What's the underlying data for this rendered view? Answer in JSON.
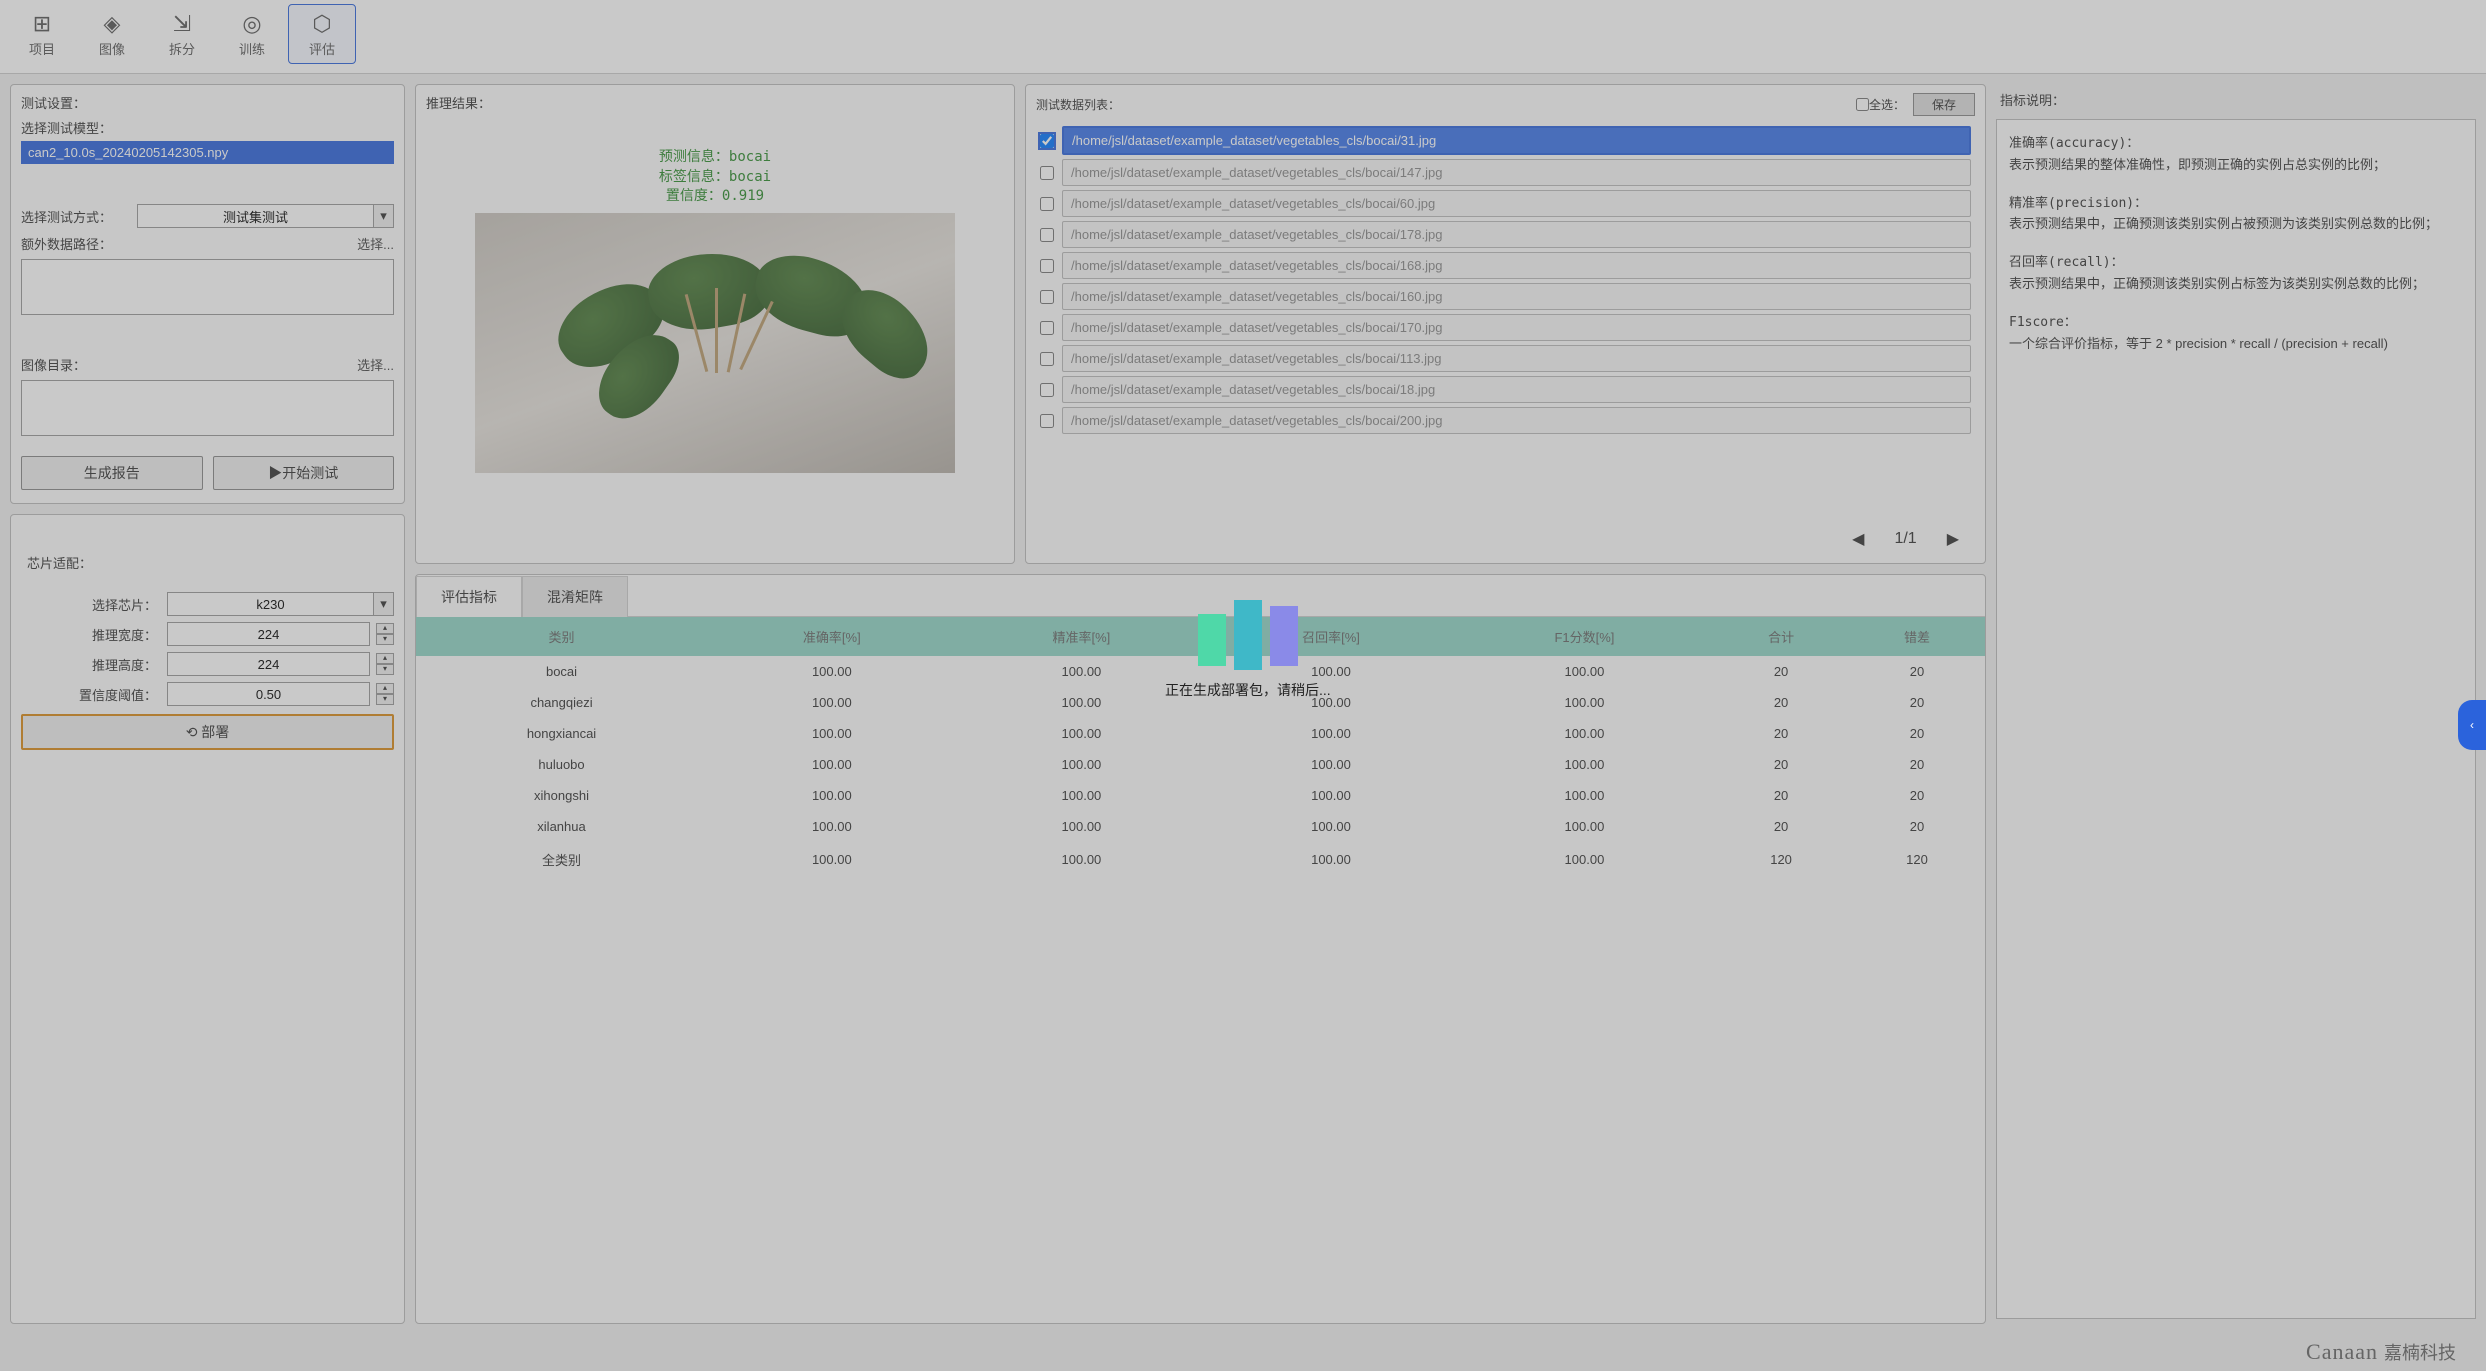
{
  "toolbar": {
    "items": [
      {
        "icon": "⊞",
        "label": "项目"
      },
      {
        "icon": "◈",
        "label": "图像"
      },
      {
        "icon": "⇲",
        "label": "拆分"
      },
      {
        "icon": "◎",
        "label": "训练"
      },
      {
        "icon": "⬡",
        "label": "评估"
      }
    ],
    "active_index": 4
  },
  "test_settings": {
    "title": "测试设置：",
    "model_label": "选择测试模型：",
    "model_value": "can2_10.0s_20240205142305.npy",
    "method_label": "选择测试方式：",
    "method_value": "测试集测试",
    "extra_path_label": "额外数据路径：",
    "extra_choose": "选择...",
    "image_dir_label": "图像目录：",
    "image_choose": "选择...",
    "gen_report": "生成报告",
    "start_test": "▶开始测试"
  },
  "chip": {
    "title": "芯片适配：",
    "chip_label": "选择芯片：",
    "chip_value": "k230",
    "width_label": "推理宽度：",
    "width_value": "224",
    "height_label": "推理高度：",
    "height_value": "224",
    "conf_label": "置信度阈值：",
    "conf_value": "0.50",
    "deploy": "⟲ 部署"
  },
  "inference": {
    "title": "推理结果：",
    "pred_line": "预测信息：bocai",
    "label_line": "标签信息：bocai",
    "conf_line": "置信度：0.919"
  },
  "datalist": {
    "title": "测试数据列表：",
    "select_all": "全选：",
    "save": "保存",
    "rows": [
      "/home/jsl/dataset/example_dataset/vegetables_cls/bocai/31.jpg",
      "/home/jsl/dataset/example_dataset/vegetables_cls/bocai/147.jpg",
      "/home/jsl/dataset/example_dataset/vegetables_cls/bocai/60.jpg",
      "/home/jsl/dataset/example_dataset/vegetables_cls/bocai/178.jpg",
      "/home/jsl/dataset/example_dataset/vegetables_cls/bocai/168.jpg",
      "/home/jsl/dataset/example_dataset/vegetables_cls/bocai/160.jpg",
      "/home/jsl/dataset/example_dataset/vegetables_cls/bocai/170.jpg",
      "/home/jsl/dataset/example_dataset/vegetables_cls/bocai/113.jpg",
      "/home/jsl/dataset/example_dataset/vegetables_cls/bocai/18.jpg",
      "/home/jsl/dataset/example_dataset/vegetables_cls/bocai/200.jpg"
    ],
    "selected_index": 0,
    "page": "1/1"
  },
  "tabs": {
    "metrics": "评估指标",
    "confusion": "混淆矩阵"
  },
  "metrics_table": {
    "headers": [
      "类别",
      "准确率[%]",
      "精准率[%]",
      "召回率[%]",
      "F1分数[%]",
      "合计",
      "错差"
    ],
    "rows": [
      [
        "bocai",
        "100.00",
        "100.00",
        "100.00",
        "100.00",
        "20",
        "20"
      ],
      [
        "changqiezi",
        "100.00",
        "100.00",
        "100.00",
        "100.00",
        "20",
        "20"
      ],
      [
        "hongxiancai",
        "100.00",
        "100.00",
        "100.00",
        "100.00",
        "20",
        "20"
      ],
      [
        "huluobo",
        "100.00",
        "100.00",
        "100.00",
        "100.00",
        "20",
        "20"
      ],
      [
        "xihongshi",
        "100.00",
        "100.00",
        "100.00",
        "100.00",
        "20",
        "20"
      ],
      [
        "xilanhua",
        "100.00",
        "100.00",
        "100.00",
        "100.00",
        "20",
        "20"
      ],
      [
        "全类别",
        "100.00",
        "100.00",
        "100.00",
        "100.00",
        "120",
        "120"
      ]
    ]
  },
  "explain": {
    "title": "指标说明：",
    "accuracy_title": "准确率(accuracy)：",
    "accuracy_body": "表示预测结果的整体准确性，即预测正确的实例占总实例的比例；",
    "precision_title": "精准率(precision)：",
    "precision_body": "表示预测结果中，正确预测该类别实例占被预测为该类别实例总数的比例；",
    "recall_title": "召回率(recall)：",
    "recall_body": "表示预测结果中，正确预测该类别实例占标签为该类别实例总数的比例；",
    "f1_title": "F1score：",
    "f1_body": "一个综合评价指标，等于 2 * precision * recall / (precision + recall)"
  },
  "spinner_text": "正在生成部署包，请稍后...",
  "footer": {
    "brand": "Canaan",
    "cn": "嘉楠科技"
  }
}
